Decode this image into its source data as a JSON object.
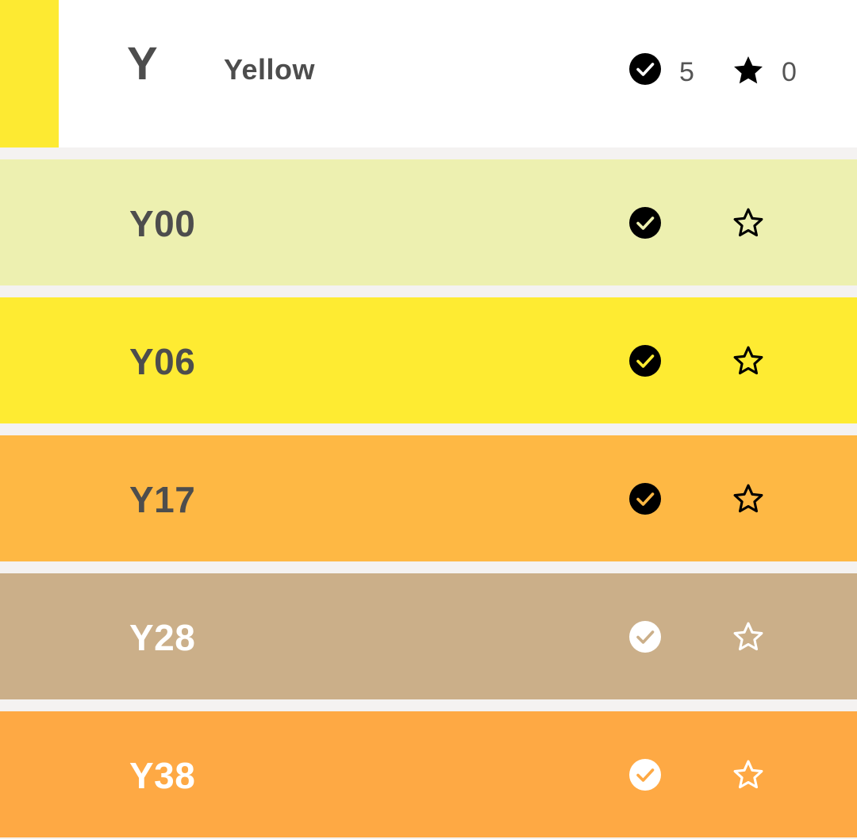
{
  "header": {
    "letter": "Y",
    "name": "Yellow",
    "swatch_color": "#fdea32",
    "owned_count": "5",
    "favorite_count": "0",
    "owned_icon": "check-circle-icon",
    "favorite_icon": "star-filled-icon"
  },
  "rows": [
    {
      "code": "Y00",
      "color": "#edf0b0",
      "text_color": "#4d4d4d",
      "owned": true,
      "favorite": false,
      "icon_style": "dark"
    },
    {
      "code": "Y06",
      "color": "#feeb32",
      "text_color": "#4d4d4d",
      "owned": true,
      "favorite": false,
      "icon_style": "dark"
    },
    {
      "code": "Y17",
      "color": "#feb844",
      "text_color": "#4d4d4d",
      "owned": true,
      "favorite": false,
      "icon_style": "dark"
    },
    {
      "code": "Y28",
      "color": "#cbaf89",
      "text_color": "#ffffff",
      "owned": true,
      "favorite": false,
      "icon_style": "light"
    },
    {
      "code": "Y38",
      "color": "#fea944",
      "text_color": "#ffffff",
      "owned": true,
      "favorite": false,
      "icon_style": "light"
    }
  ]
}
